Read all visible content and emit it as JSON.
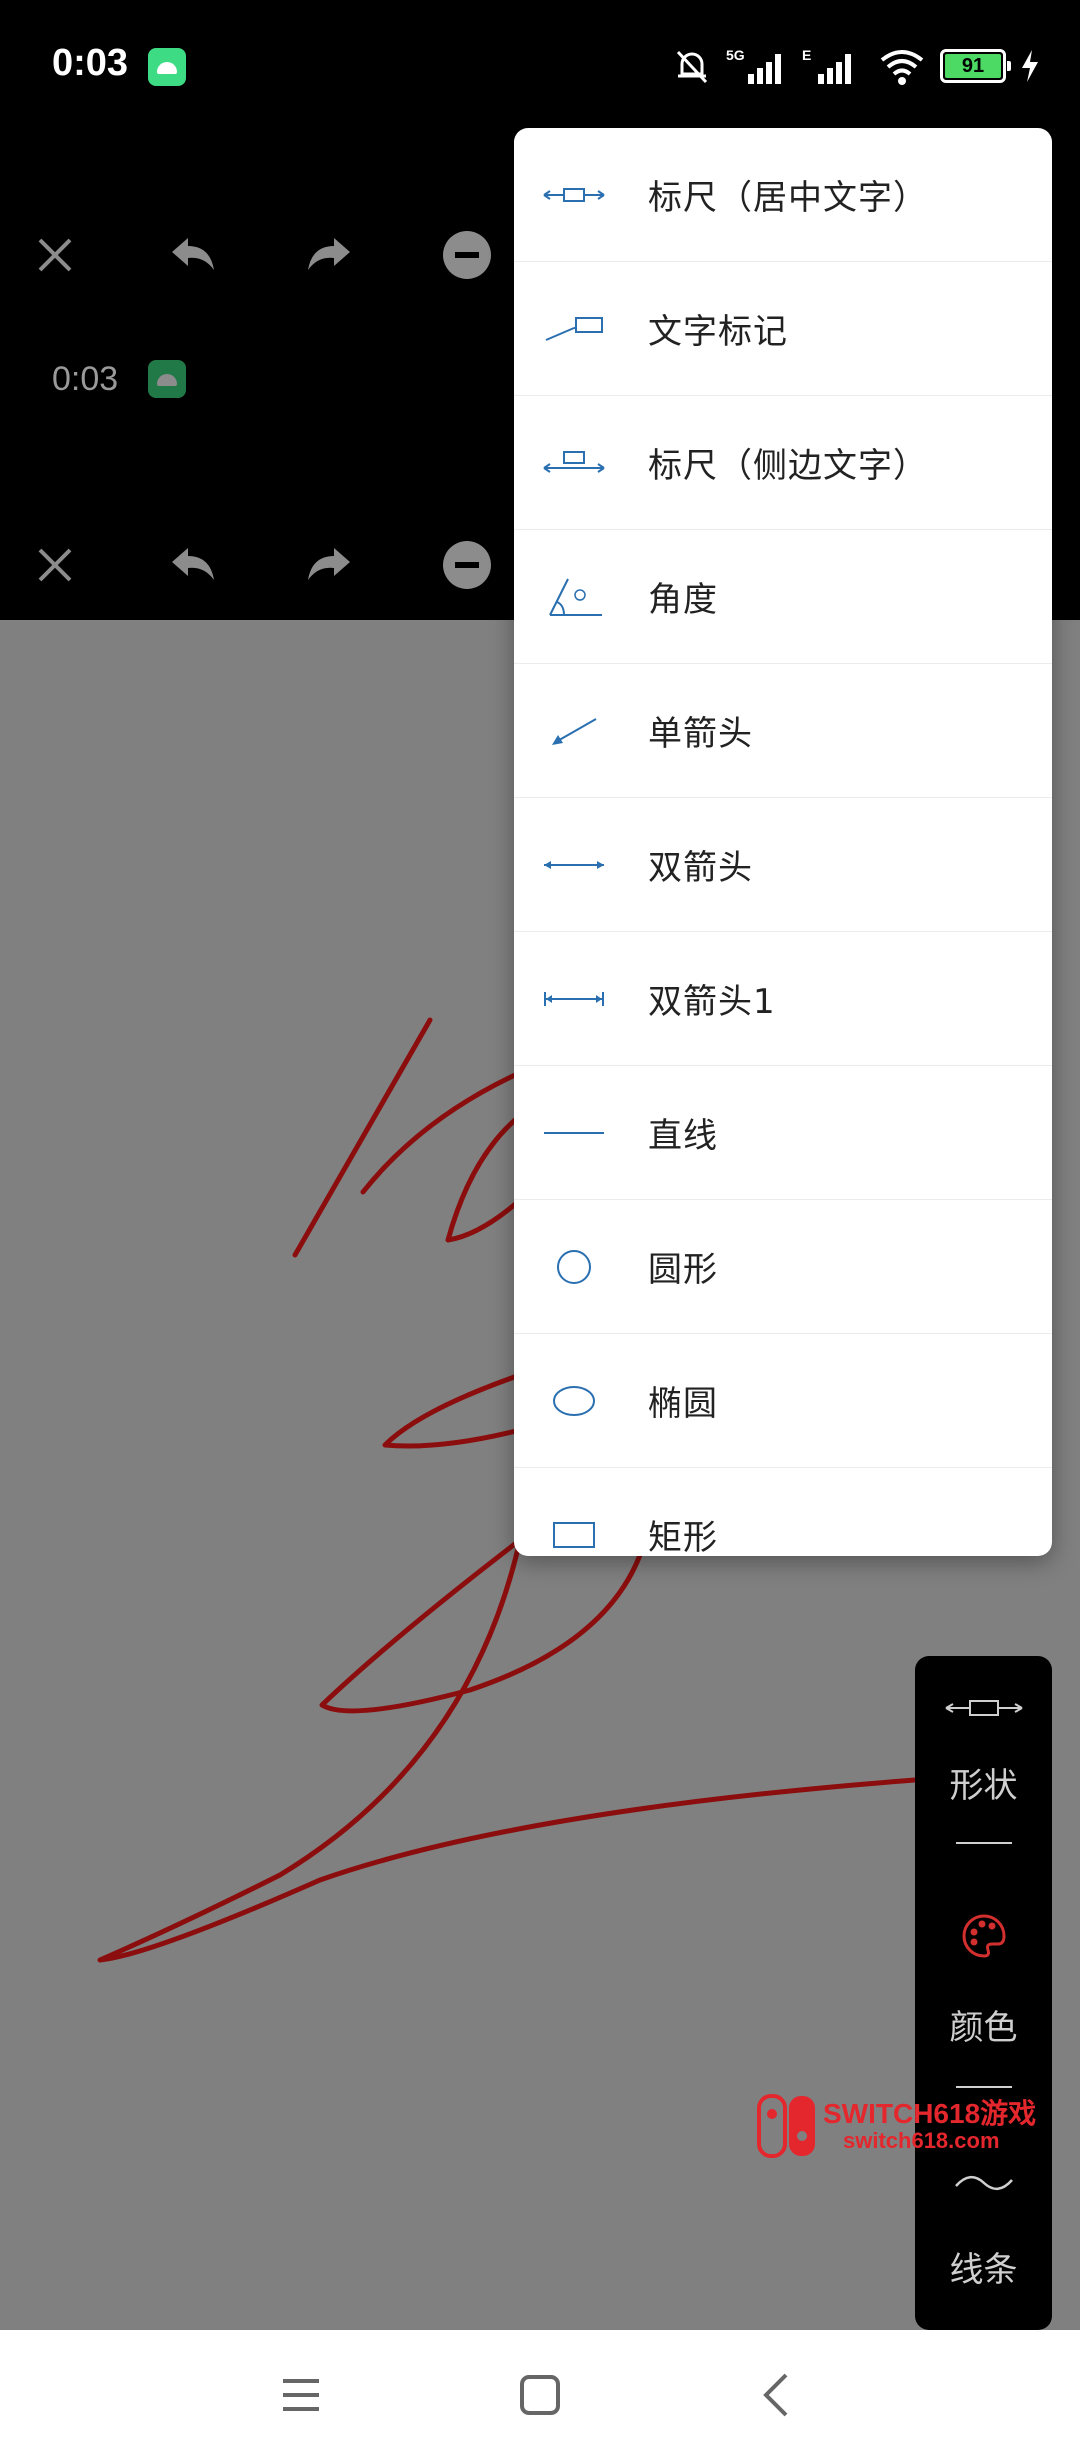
{
  "status_bar": {
    "time": "0:03",
    "network_5g": "5G",
    "network_e": "E",
    "battery": "91"
  },
  "overlay": {
    "time": "0:03"
  },
  "shape_menu": {
    "items": [
      {
        "label": "标尺（居中文字）",
        "icon": "ruler-center-text-icon"
      },
      {
        "label": "文字标记",
        "icon": "text-marker-icon"
      },
      {
        "label": "标尺（侧边文字）",
        "icon": "ruler-side-text-icon"
      },
      {
        "label": "角度",
        "icon": "angle-icon"
      },
      {
        "label": "单箭头",
        "icon": "single-arrow-icon"
      },
      {
        "label": "双箭头",
        "icon": "double-arrow-icon"
      },
      {
        "label": "双箭头1",
        "icon": "double-arrow-bar-icon"
      },
      {
        "label": "直线",
        "icon": "straight-line-icon"
      },
      {
        "label": "圆形",
        "icon": "circle-icon"
      },
      {
        "label": "椭圆",
        "icon": "ellipse-icon"
      },
      {
        "label": "矩形",
        "icon": "rectangle-icon"
      }
    ]
  },
  "side_panel": {
    "shape_label": "形状",
    "color_label": "颜色",
    "line_label": "线条"
  },
  "watermark": {
    "line1": "SWITCH618游戏",
    "line2": "switch618.com"
  },
  "colors": {
    "stroke": "#8b0d0d",
    "menu_icon": "#2a6fb0",
    "canvas": "#808080",
    "palette_accent": "#d32f2f"
  }
}
